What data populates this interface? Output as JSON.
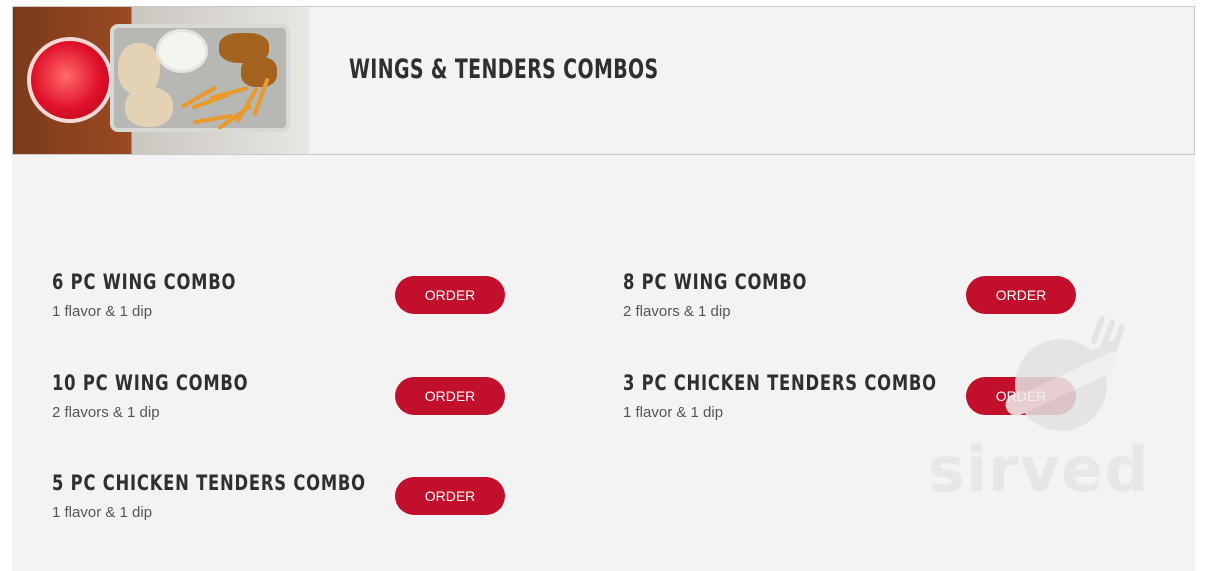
{
  "header": {
    "title": "WINGS & TENDERS COMBOS",
    "image_alt": "wings, tenders, fries, dip and drink in a tray"
  },
  "items": [
    {
      "name": "6 PC WING COMBO",
      "desc": "1 flavor & 1 dip",
      "order_label": "ORDER"
    },
    {
      "name": "8 PC WING COMBO",
      "desc": "2 flavors & 1 dip",
      "order_label": "ORDER"
    },
    {
      "name": "10 PC WING COMBO",
      "desc": "2 flavors & 1 dip",
      "order_label": "ORDER"
    },
    {
      "name": "3 PC CHICKEN TENDERS COMBO",
      "desc": "1 flavor & 1 dip",
      "order_label": "ORDER"
    },
    {
      "name": "5 PC CHICKEN TENDERS COMBO",
      "desc": "1 flavor & 1 dip",
      "order_label": "ORDER"
    }
  ],
  "watermark": {
    "text": "sirved",
    "icon": "fork-knife-icon"
  },
  "colors": {
    "accent": "#c20f2b",
    "panel": "#f3f3f3",
    "text": "#2f2f2f",
    "muted": "#555555"
  }
}
